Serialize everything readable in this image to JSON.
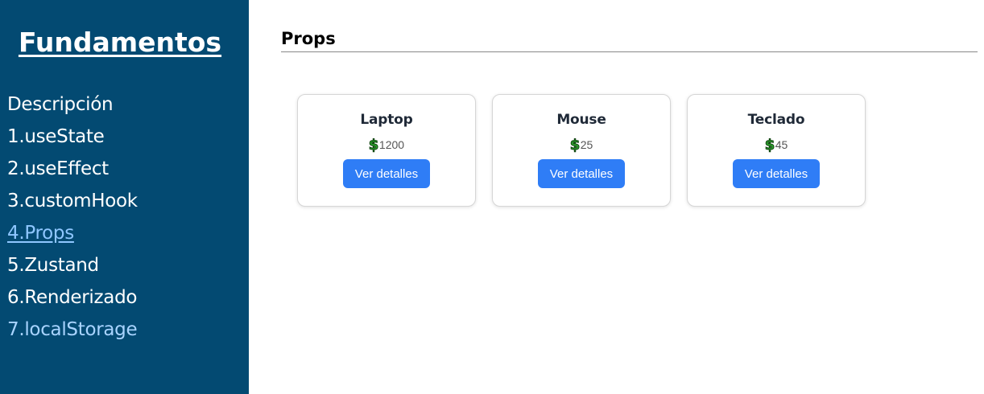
{
  "sidebar": {
    "brand": "Fundamentos",
    "items": [
      {
        "label": "Descripción"
      },
      {
        "label": "1.useState"
      },
      {
        "label": "2.useEffect"
      },
      {
        "label": "3.customHook"
      },
      {
        "label": "4.Props"
      },
      {
        "label": "5.Zustand"
      },
      {
        "label": "6.Renderizado"
      },
      {
        "label": "7.localStorage"
      }
    ],
    "active_item": "4.Props"
  },
  "main": {
    "title": "Props",
    "products": [
      {
        "name": "Laptop",
        "price": "1200",
        "button": "Ver detalles"
      },
      {
        "name": "Mouse",
        "price": "25",
        "button": "Ver detalles"
      },
      {
        "name": "Teclado",
        "price": "45",
        "button": "Ver detalles"
      }
    ]
  },
  "colors": {
    "sidebar_bg": "#034a72",
    "active_link": "#8fc7ff",
    "button_bg": "#2f7df6",
    "dollar_icon": "#2fa52f"
  },
  "icons": {
    "price": "dollar-icon"
  }
}
